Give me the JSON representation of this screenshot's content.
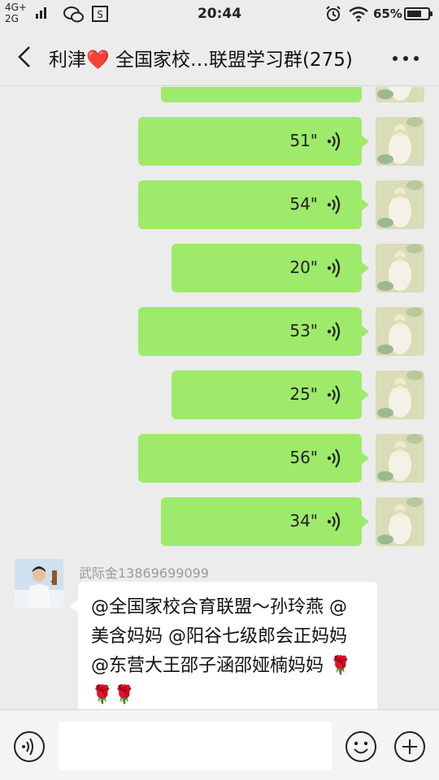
{
  "status_bar": {
    "network_top": "4G+",
    "network_bottom": "2G",
    "time": "20:44",
    "battery_percent": "65%"
  },
  "header": {
    "title_prefix": "利津",
    "title_heart": "❤️",
    "title_suffix": " 全国家校…联盟学习群(275)"
  },
  "messages_self": [
    {
      "duration": "51\""
    },
    {
      "duration": "54\""
    },
    {
      "duration": "20\""
    },
    {
      "duration": "53\""
    },
    {
      "duration": "25\""
    },
    {
      "duration": "56\""
    },
    {
      "duration": "34\""
    }
  ],
  "message_other": {
    "sender": "武际金13869699099",
    "text": "@全国家校合育联盟～孙玲燕 @美含妈妈 @阳谷七级郎会正妈妈 @东营大王邵子涵邵娅楠妈妈 ",
    "roses": "🌹🌹🌹"
  },
  "input": {
    "placeholder": ""
  },
  "colors": {
    "self_bubble": "#9eea6a",
    "other_bubble": "#ffffff",
    "background": "#ececec"
  }
}
